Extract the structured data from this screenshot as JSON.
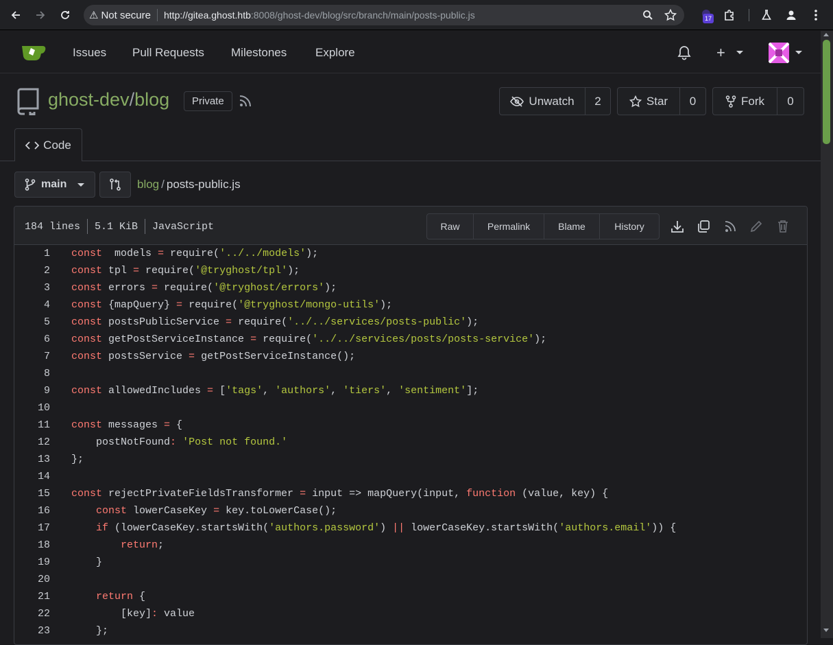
{
  "browser": {
    "security_label": "Not secure",
    "url_host": "http://gitea.ghost.htb",
    "url_rest": ":8008/ghost-dev/blog/src/branch/main/posts-public.js",
    "extension_badge": "17"
  },
  "nav": {
    "items": [
      "Issues",
      "Pull Requests",
      "Milestones",
      "Explore"
    ]
  },
  "repo": {
    "owner": "ghost-dev",
    "separator": "/",
    "name": "blog",
    "visibility": "Private",
    "unwatch_label": "Unwatch",
    "watch_count": "2",
    "star_label": "Star",
    "star_count": "0",
    "fork_label": "Fork",
    "fork_count": "0",
    "tab_code": "Code"
  },
  "branch": {
    "name": "main",
    "breadcrumb_root": "blog",
    "breadcrumb_sep": "/",
    "breadcrumb_file": "posts-public.js"
  },
  "file": {
    "lines": "184 lines",
    "size": "5.1 KiB",
    "language": "JavaScript",
    "buttons": [
      "Raw",
      "Permalink",
      "Blame",
      "History"
    ]
  },
  "colors": {
    "accent_green": "#87ab63",
    "keyword": "#ff7b72",
    "string": "#b5c83f"
  },
  "code_lines": [
    [
      [
        "k",
        "const"
      ],
      [
        "",
        "  models "
      ],
      [
        "op",
        "="
      ],
      [
        "",
        " require("
      ],
      [
        "st",
        "'../../models'"
      ],
      [
        "",
        ");"
      ]
    ],
    [
      [
        "k",
        "const"
      ],
      [
        "",
        " tpl "
      ],
      [
        "op",
        "="
      ],
      [
        "",
        " require("
      ],
      [
        "st",
        "'@tryghost/tpl'"
      ],
      [
        "",
        ");"
      ]
    ],
    [
      [
        "k",
        "const"
      ],
      [
        "",
        " errors "
      ],
      [
        "op",
        "="
      ],
      [
        "",
        " require("
      ],
      [
        "st",
        "'@tryghost/errors'"
      ],
      [
        "",
        ");"
      ]
    ],
    [
      [
        "k",
        "const"
      ],
      [
        "",
        " {mapQuery} "
      ],
      [
        "op",
        "="
      ],
      [
        "",
        " require("
      ],
      [
        "st",
        "'@tryghost/mongo-utils'"
      ],
      [
        "",
        ");"
      ]
    ],
    [
      [
        "k",
        "const"
      ],
      [
        "",
        " postsPublicService "
      ],
      [
        "op",
        "="
      ],
      [
        "",
        " require("
      ],
      [
        "st",
        "'../../services/posts-public'"
      ],
      [
        "",
        ");"
      ]
    ],
    [
      [
        "k",
        "const"
      ],
      [
        "",
        " getPostServiceInstance "
      ],
      [
        "op",
        "="
      ],
      [
        "",
        " require("
      ],
      [
        "st",
        "'../../services/posts/posts-service'"
      ],
      [
        "",
        ");"
      ]
    ],
    [
      [
        "k",
        "const"
      ],
      [
        "",
        " postsService "
      ],
      [
        "op",
        "="
      ],
      [
        "",
        " getPostServiceInstance();"
      ]
    ],
    [],
    [
      [
        "k",
        "const"
      ],
      [
        "",
        " allowedIncludes "
      ],
      [
        "op",
        "="
      ],
      [
        "",
        " ["
      ],
      [
        "st",
        "'tags'"
      ],
      [
        "",
        ", "
      ],
      [
        "st",
        "'authors'"
      ],
      [
        "",
        ", "
      ],
      [
        "st",
        "'tiers'"
      ],
      [
        "",
        ", "
      ],
      [
        "st",
        "'sentiment'"
      ],
      [
        "",
        "];"
      ]
    ],
    [],
    [
      [
        "k",
        "const"
      ],
      [
        "",
        " messages "
      ],
      [
        "op",
        "="
      ],
      [
        "",
        " {"
      ]
    ],
    [
      [
        "",
        "    postNotFound"
      ],
      [
        "op",
        ":"
      ],
      [
        "",
        " "
      ],
      [
        "st",
        "'Post not found.'"
      ]
    ],
    [
      [
        "",
        "};"
      ]
    ],
    [],
    [
      [
        "k",
        "const"
      ],
      [
        "",
        " rejectPrivateFieldsTransformer "
      ],
      [
        "op",
        "="
      ],
      [
        "",
        " input => mapQuery(input, "
      ],
      [
        "k",
        "function"
      ],
      [
        "",
        " (value, key) {"
      ]
    ],
    [
      [
        "",
        "    "
      ],
      [
        "k",
        "const"
      ],
      [
        "",
        " lowerCaseKey "
      ],
      [
        "op",
        "="
      ],
      [
        "",
        " key.toLowerCase();"
      ]
    ],
    [
      [
        "",
        "    "
      ],
      [
        "k",
        "if"
      ],
      [
        "",
        " (lowerCaseKey.startsWith("
      ],
      [
        "st",
        "'authors.password'"
      ],
      [
        "",
        ") "
      ],
      [
        "op",
        "||"
      ],
      [
        "",
        " lowerCaseKey.startsWith("
      ],
      [
        "st",
        "'authors.email'"
      ],
      [
        "",
        ")) {"
      ]
    ],
    [
      [
        "",
        "        "
      ],
      [
        "k",
        "return"
      ],
      [
        "",
        ";"
      ]
    ],
    [
      [
        "",
        "    }"
      ]
    ],
    [],
    [
      [
        "",
        "    "
      ],
      [
        "k",
        "return"
      ],
      [
        "",
        " {"
      ]
    ],
    [
      [
        "",
        "        [key]"
      ],
      [
        "op",
        ":"
      ],
      [
        "",
        " value"
      ]
    ],
    [
      [
        "",
        "    };"
      ]
    ]
  ]
}
